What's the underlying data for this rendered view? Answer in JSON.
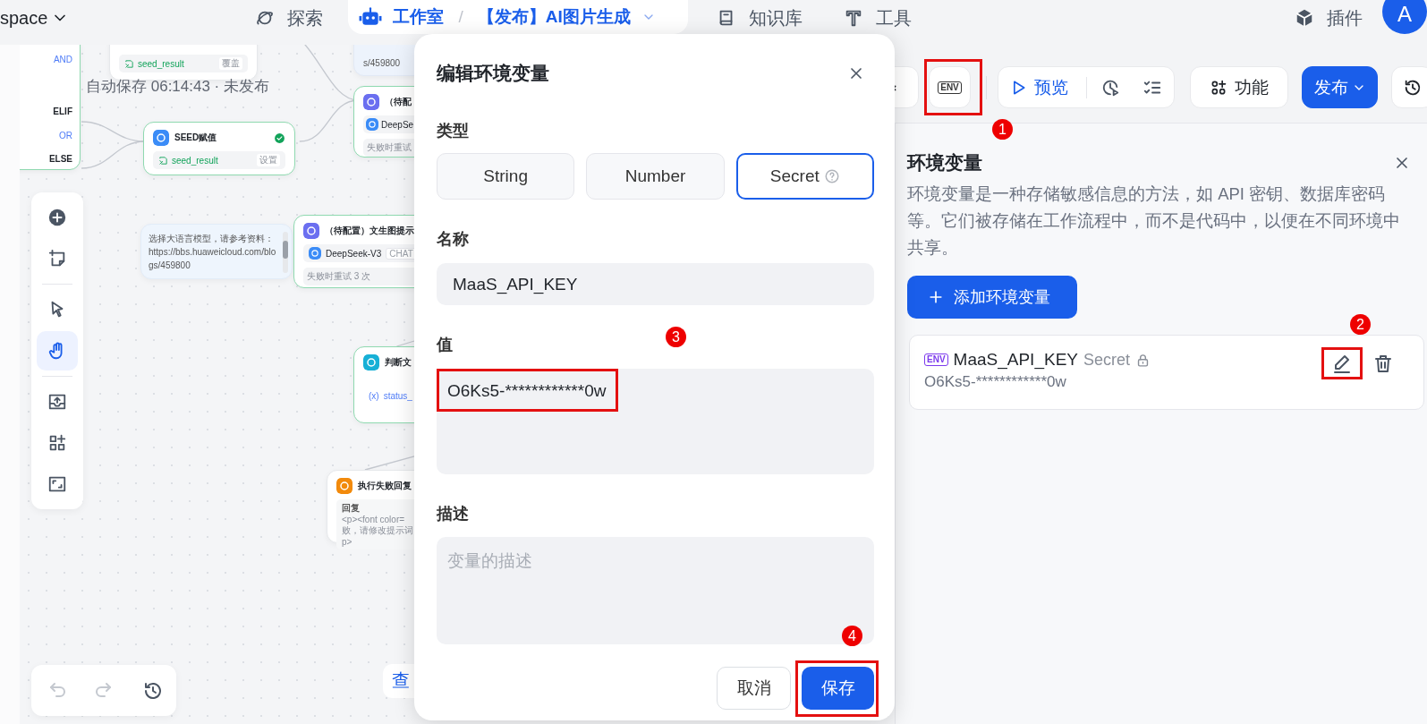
{
  "top_nav": {
    "workspace": "space",
    "explore": "探索",
    "studio": "工作室",
    "separator": "/",
    "app_title": "【发布】AI图片生成",
    "knowledge": "知识库",
    "tools": "工具",
    "plugins": "插件",
    "avatar": "A"
  },
  "canvas": {
    "autosave": "自动保存 06:14:43 · 未发布",
    "nodes": [
      {
        "kind": "branch",
        "branches": [
          {
            "label": "AND",
            "kind": "logic"
          },
          {
            "label": "ELIF",
            "kind": "branch"
          },
          {
            "label": "OR",
            "kind": "logic"
          },
          {
            "label": "ELSE",
            "kind": "branch"
          }
        ]
      },
      {
        "kind": "output",
        "outputs": [
          {
            "name": "seed_result",
            "action": "覆盖"
          }
        ]
      },
      {
        "kind": "text",
        "lines": [
          "s/459800"
        ]
      },
      {
        "kind": "llm",
        "title": "（待配",
        "model": "DeepSe",
        "retry": "失败时重试"
      },
      {
        "kind": "assign",
        "title": "SEED赋值",
        "done": true,
        "outputs": [
          {
            "name": "seed_result",
            "action": "设置"
          }
        ]
      },
      {
        "kind": "note",
        "text": "选择大语言模型，请参考资料：https://bbs.huaweicloud.com/blogs/459800"
      },
      {
        "kind": "llm",
        "title": "（待配置）文生图提示",
        "model": "DeepSeek-V3",
        "model_tag": "CHAT",
        "retry": "失败时重试 3 次"
      },
      {
        "kind": "condition",
        "title": "判断文",
        "variable_icon": "(x)",
        "variable": "status_"
      },
      {
        "kind": "reply",
        "title": "执行失败回复",
        "label": "回复",
        "lines": [
          "<p><font color=",
          "败，请修改提示词",
          "p>"
        ]
      }
    ],
    "tool_groups": [
      [
        {
          "kind": "add",
          "selected": false
        },
        {
          "kind": "note",
          "selected": false
        }
      ],
      [
        {
          "kind": "pointer",
          "selected": false
        },
        {
          "kind": "hand",
          "selected": true
        }
      ],
      [
        {
          "kind": "import",
          "selected": false
        },
        {
          "kind": "components",
          "selected": false
        },
        {
          "kind": "fit",
          "selected": false
        }
      ]
    ],
    "history_groups": [
      [
        {
          "kind": "undo",
          "disabled": true
        },
        {
          "kind": "redo",
          "disabled": true
        }
      ],
      [
        {
          "kind": "history",
          "disabled": false
        }
      ]
    ],
    "partial_button": "查"
  },
  "toolbar": [
    {
      "kind": "variables",
      "highlighted": false
    },
    {
      "kind": "env",
      "label": "ENV",
      "highlighted": true,
      "marker": "1"
    },
    {
      "kind": "preview",
      "label": "预览",
      "highlighted": false
    },
    {
      "kind": "features",
      "label": "功能",
      "highlighted": false
    },
    {
      "kind": "publish",
      "label": "发布",
      "highlighted": false
    },
    {
      "kind": "history",
      "highlighted": false
    }
  ],
  "env_panel": {
    "title": "环境变量",
    "description": "环境变量是一种存储敏感信息的方法，如 API 密钥、数据库密码等。它们被存储在工作流程中，而不是代码中，以便在不同环境中共享。",
    "add_button": "添加环境变量",
    "variables": [
      {
        "badge": "ENV",
        "name": "MaaS_API_KEY",
        "type": "Secret",
        "locked": true,
        "value": "O6Ks5-************0w",
        "edit_highlighted": true,
        "edit_marker": "2"
      }
    ]
  },
  "dialog": {
    "title": "编辑环境变量",
    "type_label": "类型",
    "types": [
      {
        "label": "String",
        "selected": false,
        "help": false
      },
      {
        "label": "Number",
        "selected": false,
        "help": false
      },
      {
        "label": "Secret",
        "selected": true,
        "help": true
      }
    ],
    "name_label": "名称",
    "name_value": "MaaS_API_KEY",
    "value_label": "值",
    "value": "O6Ks5-************0w",
    "value_highlighted": true,
    "value_marker": "3",
    "description_label": "描述",
    "description_placeholder": "变量的描述",
    "cancel": "取消",
    "save": "保存",
    "save_highlighted": true,
    "save_marker": "4"
  }
}
